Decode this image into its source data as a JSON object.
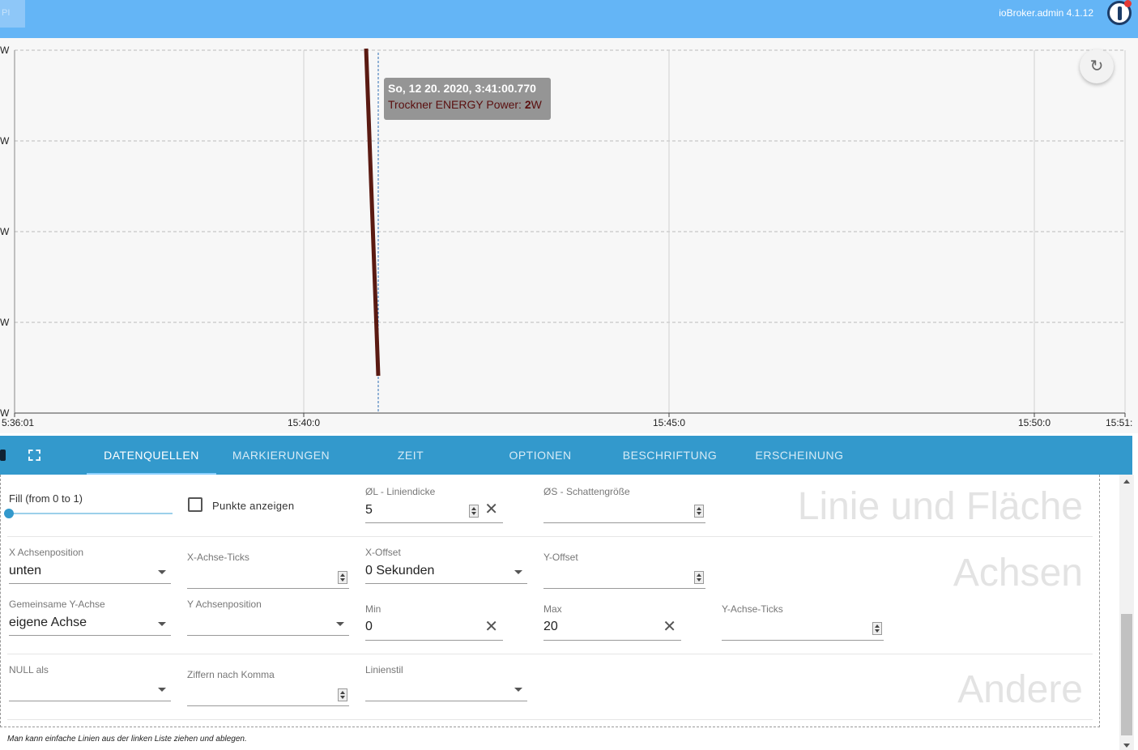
{
  "app": {
    "version": "ioBroker.admin 4.1.12",
    "corner_label": "PI"
  },
  "chart": {
    "y_tick_labels": [
      "W",
      "W",
      "W",
      "W",
      "W"
    ],
    "x_tick_labels": [
      "5:36:01",
      "15:40:0",
      "15:45:0",
      "15:50:0",
      "15:51:"
    ],
    "tooltip": {
      "date": "So, 12 20. 2020, 3:41:00.770",
      "series_label": "Trockner ENERGY Power:",
      "value": "2",
      "unit": "W"
    },
    "line_color": "#5a1a12",
    "crosshair_color": "#2f6fb5"
  },
  "tabs": [
    "DATENQUELLEN",
    "MARKIERUNGEN",
    "ZEIT",
    "OPTIONEN",
    "BESCHRIFTUNG",
    "ERSCHEINUNG"
  ],
  "sections": {
    "line_area": "Linie und Fläche",
    "axes": "Achsen",
    "other": "Andere"
  },
  "fields": {
    "fill": {
      "label": "Fill (from 0 to 1)",
      "value": 0
    },
    "show_points": {
      "label": "Punkte anzeigen"
    },
    "line_width": {
      "label": "ØL - Liniendicke",
      "value": "5"
    },
    "shadow_size": {
      "label": "ØS - Schattengröße",
      "value": ""
    },
    "x_axis_pos": {
      "label": "X Achsenposition",
      "value": "unten"
    },
    "x_axis_ticks": {
      "label": "X-Achse-Ticks",
      "value": ""
    },
    "x_offset": {
      "label": "X-Offset",
      "value": "0 Sekunden"
    },
    "y_offset": {
      "label": "Y-Offset",
      "value": ""
    },
    "common_y_axis": {
      "label": "Gemeinsame Y-Achse",
      "value": "eigene Achse"
    },
    "y_axis_pos": {
      "label": "Y Achsenposition",
      "value": ""
    },
    "min": {
      "label": "Min",
      "value": "0"
    },
    "max": {
      "label": "Max",
      "value": "20"
    },
    "y_axis_ticks": {
      "label": "Y-Achse-Ticks",
      "value": ""
    },
    "null_as": {
      "label": "NULL als",
      "value": ""
    },
    "decimals": {
      "label": "Ziffern nach Komma",
      "value": ""
    },
    "line_style": {
      "label": "Linienstil",
      "value": ""
    }
  },
  "hint": "Man kann einfache Linien aus der linken Liste ziehen und ablegen."
}
